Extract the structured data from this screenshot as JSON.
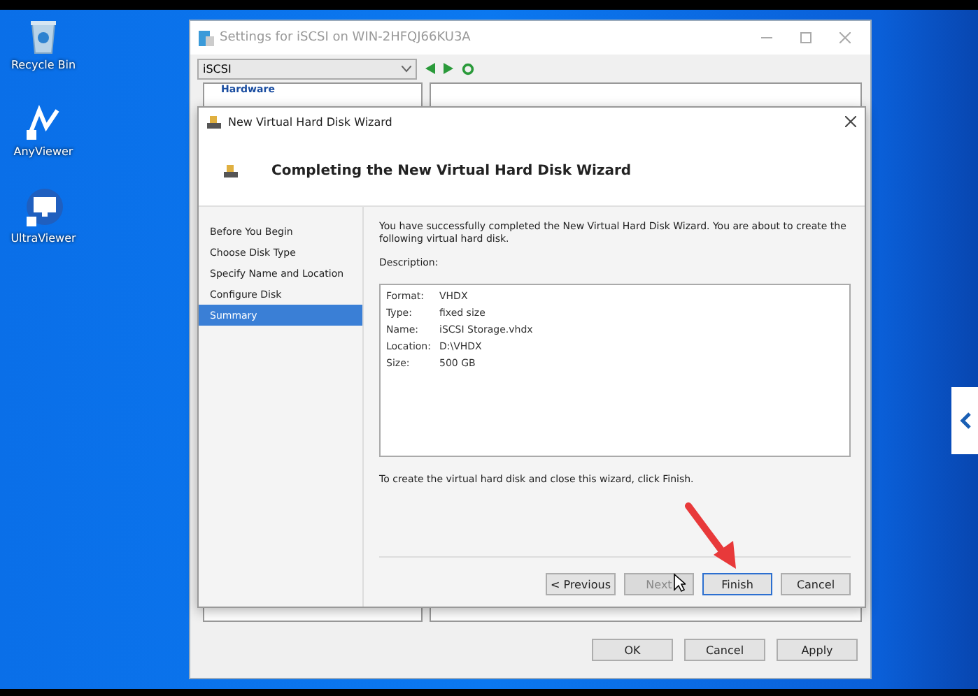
{
  "desktop_icons": [
    {
      "kind": "bin",
      "label": "Recycle Bin"
    },
    {
      "kind": "any",
      "label": "AnyViewer"
    },
    {
      "kind": "ultra",
      "label": "UltraViewer"
    }
  ],
  "settings_window": {
    "title": "Settings for iSCSI on WIN-2HFQJ66KU3A",
    "vm_select": "iSCSI",
    "tree_heading": "Hardware",
    "buttons": [
      {
        "label": "OK"
      },
      {
        "label": "Cancel"
      },
      {
        "label": "Apply"
      }
    ]
  },
  "wizard": {
    "title": "New Virtual Hard Disk Wizard",
    "heading": "Completing the New Virtual Hard Disk Wizard",
    "steps": [
      {
        "label": "Before You Begin",
        "selected": false
      },
      {
        "label": "Choose Disk Type",
        "selected": false
      },
      {
        "label": "Specify Name and Location",
        "selected": false
      },
      {
        "label": "Configure Disk",
        "selected": false
      },
      {
        "label": "Summary",
        "selected": true
      }
    ],
    "intro": "You have successfully completed the New Virtual Hard Disk Wizard. You are about to create the following virtual hard disk.",
    "description_label": "Description:",
    "summary": [
      {
        "key": "Format:",
        "value": "VHDX"
      },
      {
        "key": "Type:",
        "value": "fixed size"
      },
      {
        "key": "Name:",
        "value": "iSCSI Storage.vhdx"
      },
      {
        "key": "Location:",
        "value": "D:\\VHDX"
      },
      {
        "key": "Size:",
        "value": "500 GB"
      }
    ],
    "outro": "To create the virtual hard disk and close this wizard, click Finish.",
    "buttons": [
      {
        "label": "< Previous",
        "disabled": false,
        "focused": false
      },
      {
        "label": "Next",
        "disabled": true,
        "focused": false
      },
      {
        "label": "Finish",
        "disabled": false,
        "focused": true
      },
      {
        "label": "Cancel",
        "disabled": false,
        "focused": false
      }
    ]
  }
}
